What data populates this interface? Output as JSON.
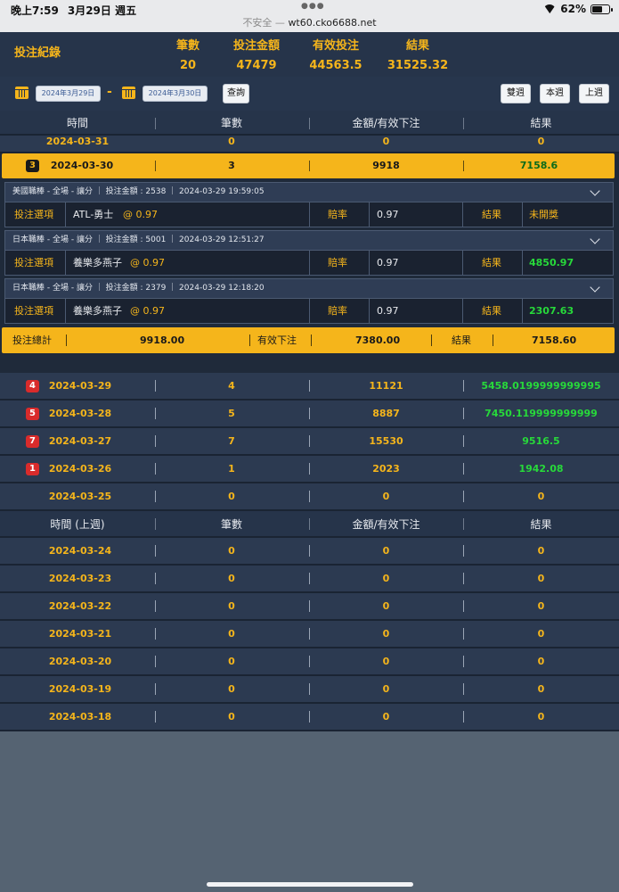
{
  "status_bar": {
    "time": "晚上7:59",
    "date": "3月29日 週五",
    "insecure_label": "不安全 —",
    "url": "wt60.cko6688.net",
    "battery": "62%",
    "battery_level": 0.62
  },
  "summary": {
    "title": "投注紀錄",
    "columns": [
      {
        "label": "筆數",
        "value": "20"
      },
      {
        "label": "投注金額",
        "value": "47479"
      },
      {
        "label": "有效投注",
        "value": "44563.5"
      },
      {
        "label": "結果",
        "value": "31525.32"
      }
    ]
  },
  "controls": {
    "date_from": "2024年3月29日",
    "separator": "-",
    "date_to": "2024年3月30日",
    "query_label": "查詢",
    "two_weeks_label": "雙週",
    "this_week_label": "本週",
    "last_week_label": "上週"
  },
  "table": {
    "headers": [
      "時間",
      "筆數",
      "金額/有效下注",
      "結果"
    ],
    "rows_before": [
      {
        "date": "2024-03-31",
        "count": "0",
        "amount": "0",
        "result": "0",
        "badge": ""
      }
    ],
    "selected": {
      "badge": "3",
      "date": "2024-03-30",
      "count": "3",
      "amount": "9918",
      "result": "7158.6"
    },
    "details": [
      {
        "header": "美國職棒 - 全場 - 讓分 ｜ 投注金額 : 2538 ｜ 2024-03-29 19:59:05",
        "bet_label": "投注選項",
        "selection": "ATL-勇士",
        "odds_text": "@ 0.97",
        "odds_label": "賠率",
        "odds": "0.97",
        "result_label": "結果",
        "result": "未開獎",
        "result_green": false
      },
      {
        "header": "日本職棒 - 全場 - 讓分 ｜ 投注金額 : 5001 ｜ 2024-03-29 12:51:27",
        "bet_label": "投注選項",
        "selection": "養樂多燕子",
        "odds_text": "@ 0.97",
        "odds_label": "賠率",
        "odds": "0.97",
        "result_label": "結果",
        "result": "4850.97",
        "result_green": true
      },
      {
        "header": "日本職棒 - 全場 - 讓分 ｜ 投注金額 : 2379 ｜ 2024-03-29 12:18:20",
        "bet_label": "投注選項",
        "selection": "養樂多燕子",
        "odds_text": "@ 0.97",
        "odds_label": "賠率",
        "odds": "0.97",
        "result_label": "結果",
        "result": "2307.63",
        "result_green": true
      }
    ],
    "total": {
      "label": "投注總計",
      "amount": "9918.00",
      "valid_label": "有效下注",
      "valid": "7380.00",
      "result_label": "結果",
      "result": "7158.60"
    },
    "rows_after": [
      {
        "badge": "4",
        "date": "2024-03-29",
        "count": "4",
        "amount": "11121",
        "result": "5458.0199999999995",
        "green": true
      },
      {
        "badge": "5",
        "date": "2024-03-28",
        "count": "5",
        "amount": "8887",
        "result": "7450.119999999999",
        "green": true
      },
      {
        "badge": "7",
        "date": "2024-03-27",
        "count": "7",
        "amount": "15530",
        "result": "9516.5",
        "green": true
      },
      {
        "badge": "1",
        "date": "2024-03-26",
        "count": "1",
        "amount": "2023",
        "result": "1942.08",
        "green": true
      },
      {
        "badge": "",
        "date": "2024-03-25",
        "count": "0",
        "amount": "0",
        "result": "0",
        "green": false
      }
    ],
    "last_week_headers": [
      "時間 (上週)",
      "筆數",
      "金額/有效下注",
      "結果"
    ],
    "last_week_rows": [
      {
        "date": "2024-03-24",
        "count": "0",
        "amount": "0",
        "result": "0"
      },
      {
        "date": "2024-03-23",
        "count": "0",
        "amount": "0",
        "result": "0"
      },
      {
        "date": "2024-03-22",
        "count": "0",
        "amount": "0",
        "result": "0"
      },
      {
        "date": "2024-03-21",
        "count": "0",
        "amount": "0",
        "result": "0"
      },
      {
        "date": "2024-03-20",
        "count": "0",
        "amount": "0",
        "result": "0"
      },
      {
        "date": "2024-03-19",
        "count": "0",
        "amount": "0",
        "result": "0"
      },
      {
        "date": "2024-03-18",
        "count": "0",
        "amount": "0",
        "result": "0"
      }
    ]
  },
  "colors": {
    "accent": "#f5b51b",
    "positive": "#27d93a",
    "badge": "#d92b2b",
    "panel": "#2c3a51"
  }
}
